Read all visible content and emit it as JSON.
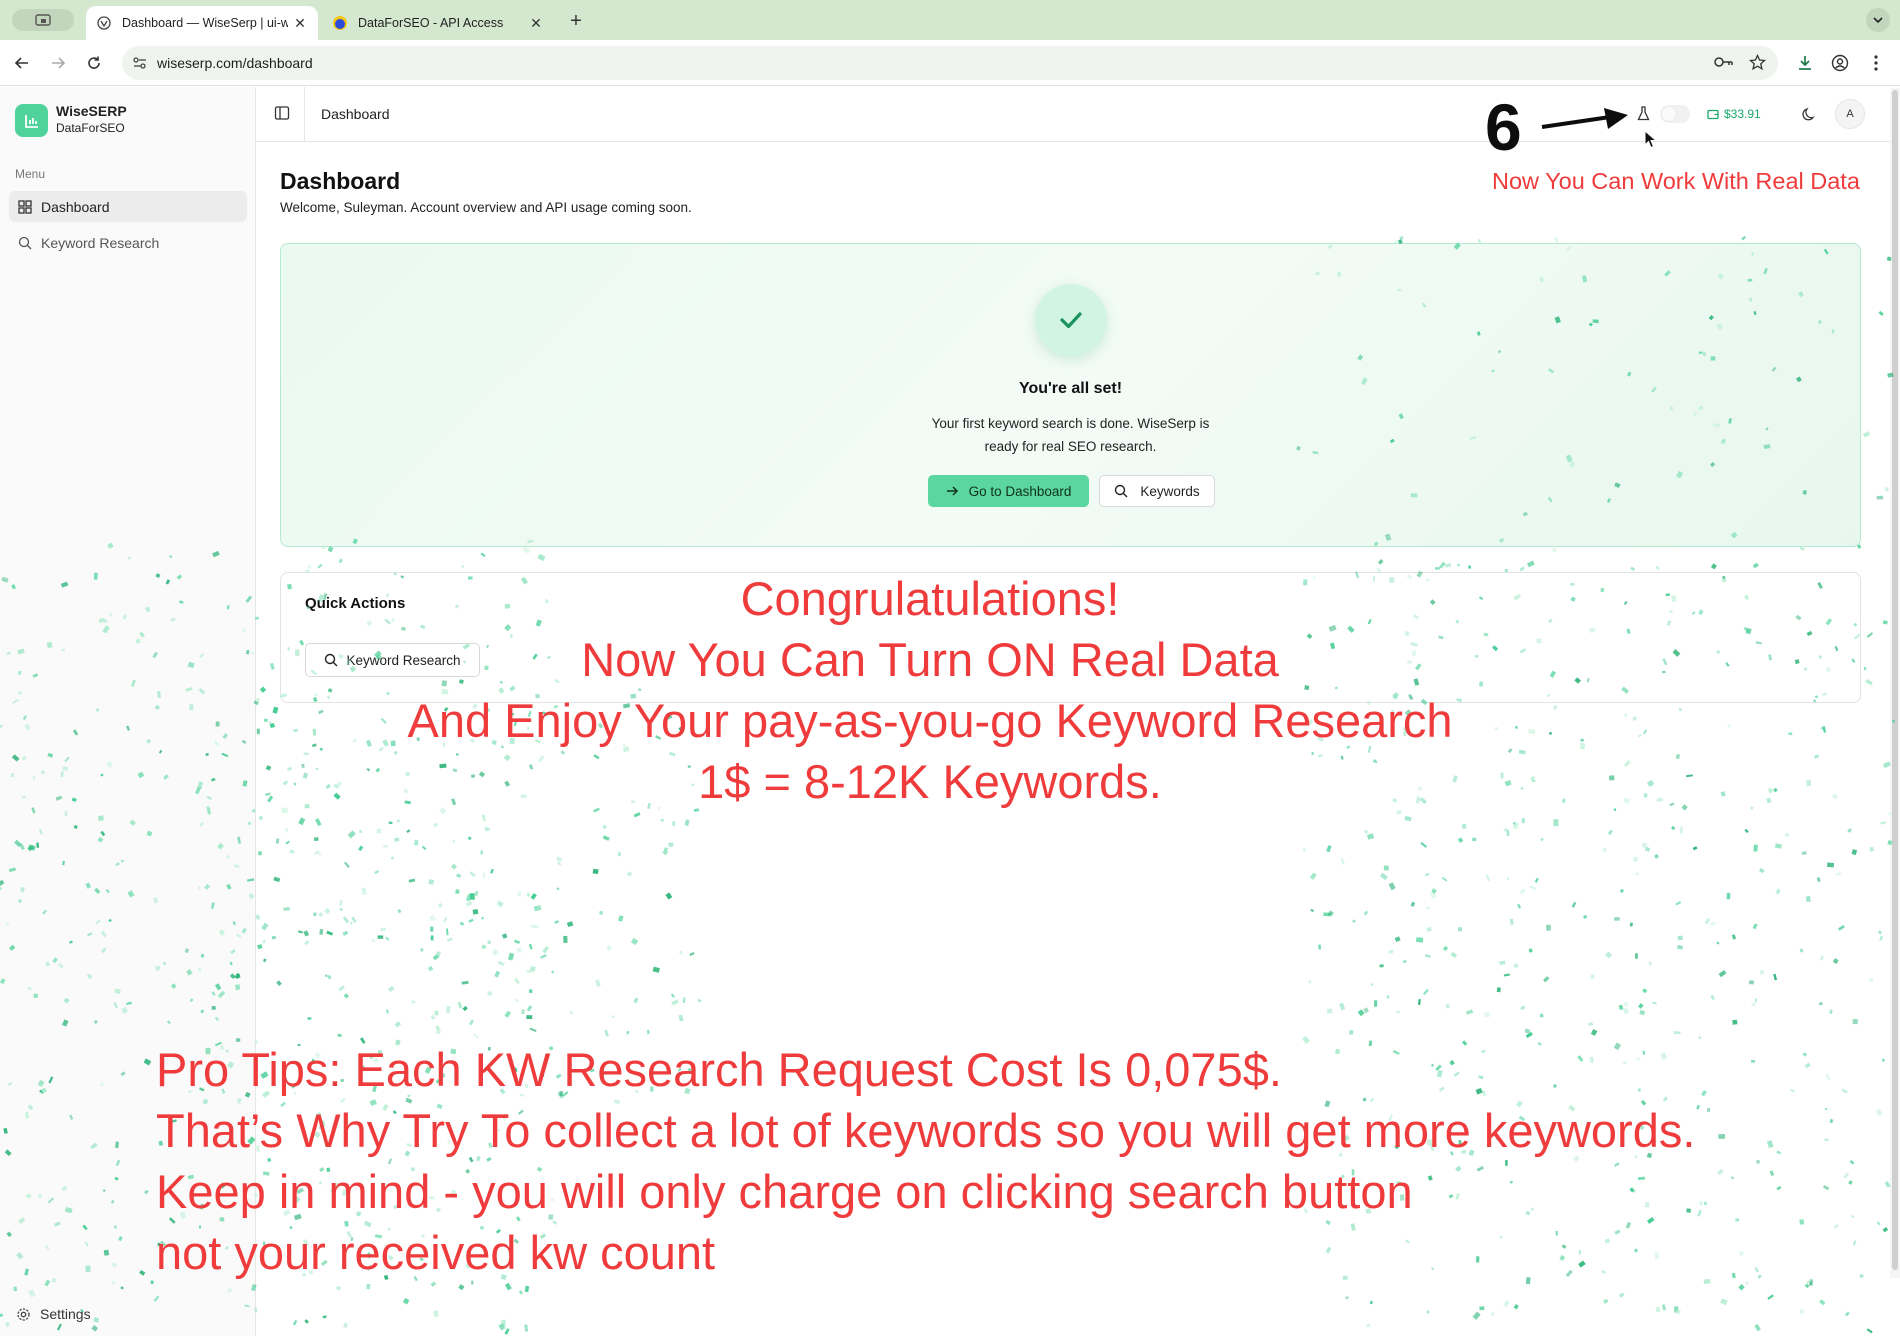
{
  "browser": {
    "tabs": [
      {
        "title": "Dashboard — WiseSerp | ui-w",
        "active": true
      },
      {
        "title": "DataForSEO - API Access",
        "active": false
      }
    ],
    "url": "wiseserp.com/dashboard"
  },
  "sidebar": {
    "brand_name": "WiseSERP",
    "brand_sub": "DataForSEO",
    "menu_label": "Menu",
    "items": [
      {
        "label": "Dashboard",
        "icon": "grid-icon",
        "active": true
      },
      {
        "label": "Keyword Research",
        "icon": "search-icon",
        "active": false
      }
    ],
    "settings_label": "Settings"
  },
  "header": {
    "title": "Dashboard",
    "balance": "$33.91",
    "avatar_initial": "A"
  },
  "main": {
    "title": "Dashboard",
    "subtitle": "Welcome, Suleyman. Account overview and API usage coming soon.",
    "success": {
      "title": "You're all set!",
      "line1": "Your first keyword search is done. WiseSerp is",
      "line2": "ready for real SEO research.",
      "primary_button": "Go to Dashboard",
      "secondary_button": "Keywords"
    },
    "quick_actions": {
      "title": "Quick Actions",
      "button": "Keyword Research"
    }
  },
  "overlay": {
    "step_number": "6",
    "right_note": "Now You Can Work With Real Data",
    "center_lines": [
      "Congrulatulations!",
      "Now You Can Turn ON Real Data",
      "And Enjoy Your pay-as-you-go Keyword Research",
      "1$ = 8-12K Keywords."
    ],
    "tip_lines": [
      "Pro Tips: Each KW Research Request Cost Is 0,075$.",
      "That’s Why Try To collect a lot of keywords so you will get more keywords.",
      "Keep in mind - you will only charge on clicking search button",
      "not your received kw count"
    ]
  },
  "colors": {
    "accent_green": "#5bd69e",
    "overlay_red": "#ef3b3b",
    "chrome_bg": "#d4e8d0"
  }
}
